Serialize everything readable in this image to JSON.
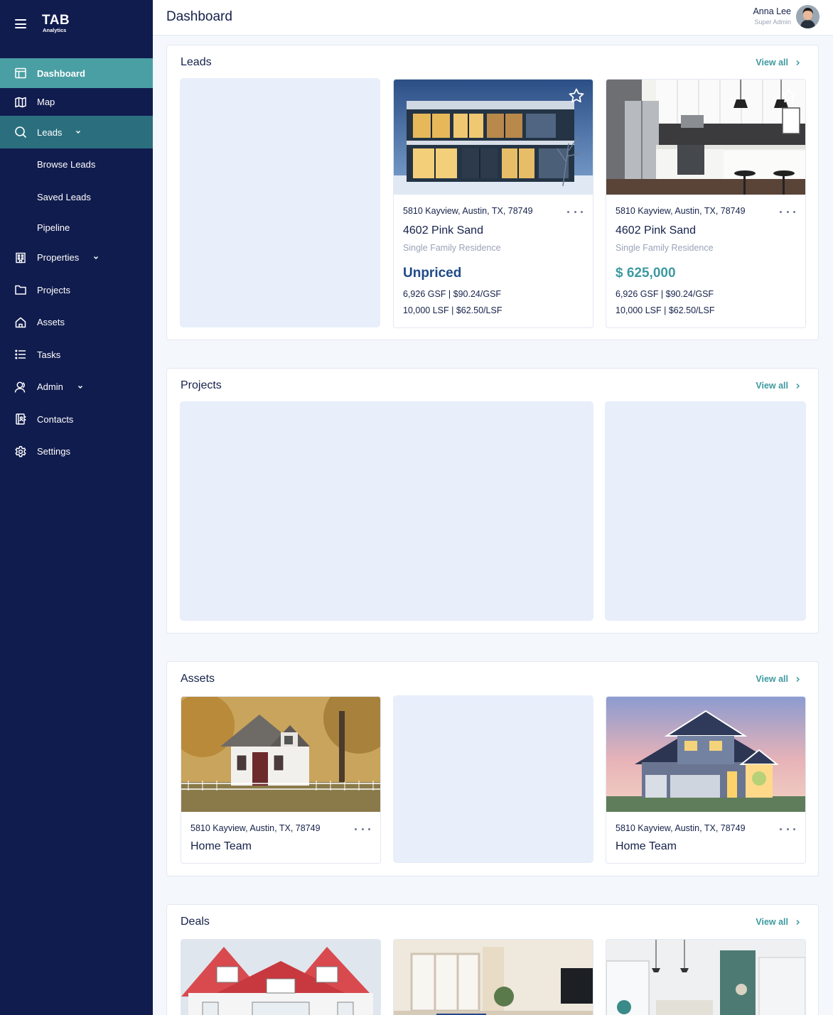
{
  "app": {
    "logo": "TAB",
    "logo_sub": "Analytics"
  },
  "header": {
    "title": "Dashboard",
    "user_name": "Anna Lee",
    "user_role": "Super Admin"
  },
  "sidebar": {
    "items": [
      {
        "label": "Dashboard",
        "icon": "dashboard-icon"
      },
      {
        "label": "Map",
        "icon": "map-icon"
      },
      {
        "label": "Leads",
        "icon": "search-icon"
      },
      {
        "label": "Browse Leads"
      },
      {
        "label": "Saved Leads"
      },
      {
        "label": "Pipeline"
      },
      {
        "label": "Properties",
        "icon": "building-icon"
      },
      {
        "label": "Projects",
        "icon": "folder-icon"
      },
      {
        "label": "Assets",
        "icon": "home-icon"
      },
      {
        "label": "Tasks",
        "icon": "list-icon"
      },
      {
        "label": "Admin",
        "icon": "user-icon"
      },
      {
        "label": "Contacts",
        "icon": "contacts-icon"
      },
      {
        "label": "Settings",
        "icon": "gear-icon"
      }
    ]
  },
  "view_all": "View all",
  "leads": {
    "title": "Leads",
    "cards": [
      {
        "address": "5810 Kayview, Austin, TX, 78749",
        "name": "4602 Pink Sand",
        "type": "Single Family Residence",
        "price": "Unpriced",
        "gsf": "6,926 GSF | $90.24/GSF",
        "lsf": "10,000 LSF | $62.50/LSF"
      },
      {
        "address": "5810 Kayview, Austin, TX, 78749",
        "name": "4602 Pink Sand",
        "type": "Single Family Residence",
        "price": "$ 625,000",
        "gsf": "6,926 GSF | $90.24/GSF",
        "lsf": "10,000 LSF | $62.50/LSF"
      }
    ]
  },
  "projects": {
    "title": "Projects"
  },
  "assets": {
    "title": "Assets",
    "cards": [
      {
        "address": "5810 Kayview, Austin, TX, 78749",
        "name": "Home Team"
      },
      {
        "address": "5810 Kayview, Austin, TX, 78749",
        "name": "Home Team"
      }
    ]
  },
  "deals": {
    "title": "Deals"
  },
  "colors": {
    "sidebar": "#111c4e",
    "accent": "#4a9fa4",
    "accent_dark": "#2b6f7e",
    "placeholder": "#e8eefa"
  }
}
